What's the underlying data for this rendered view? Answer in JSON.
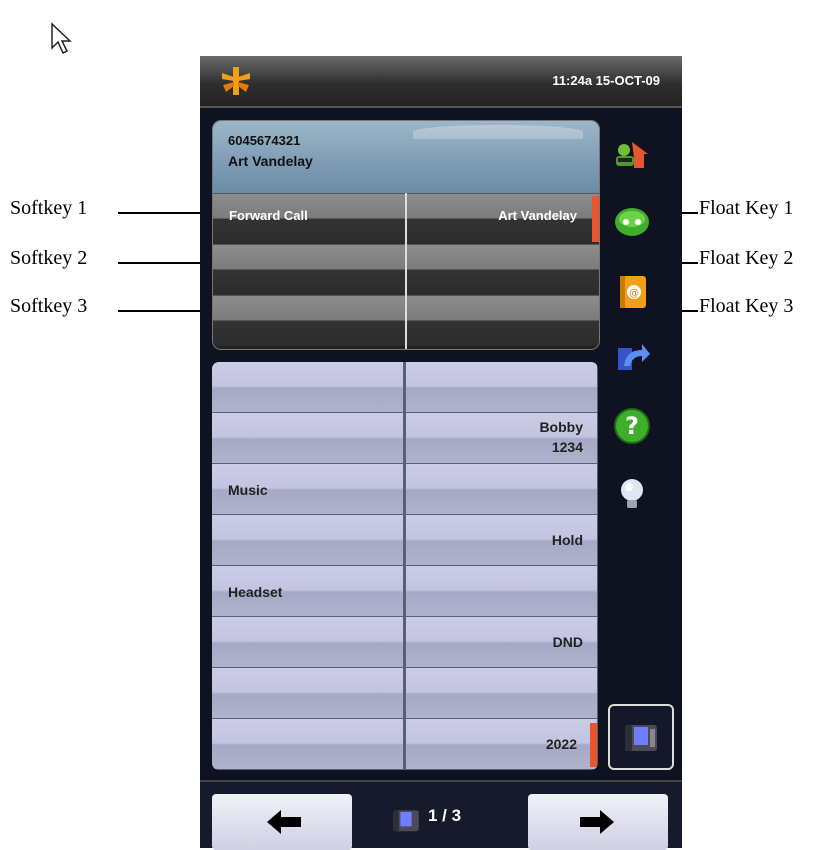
{
  "status_bar": {
    "time": "11:24a 15-OCT-09"
  },
  "caller": {
    "number": "6045674321",
    "name": "Art Vandelay"
  },
  "softkeys": [
    {
      "label": "Forward Call"
    },
    {
      "label": ""
    },
    {
      "label": ""
    }
  ],
  "float_keys": [
    {
      "label": "Art Vandelay"
    },
    {
      "label": ""
    },
    {
      "label": ""
    }
  ],
  "programmable_keys": {
    "left": [
      "",
      "",
      "Music",
      "",
      "Headset",
      "",
      "",
      ""
    ],
    "right": [
      {
        "line1": "",
        "line2": ""
      },
      {
        "line1": "Bobby",
        "line2": "1234"
      },
      {
        "line1": "",
        "line2": ""
      },
      {
        "line1": "Hold",
        "line2": ""
      },
      {
        "line1": "",
        "line2": ""
      },
      {
        "line1": "DND",
        "line2": ""
      },
      {
        "line1": "",
        "line2": ""
      },
      {
        "line1": "2022",
        "line2": ""
      }
    ]
  },
  "navigation": {
    "page": "1 / 3"
  },
  "callouts": {
    "softkey_1": "Softkey 1",
    "softkey_2": "Softkey 2",
    "softkey_3": "Softkey 3",
    "float_key_1": "Float Key 1",
    "float_key_2": "Float Key 2",
    "float_key_3": "Float Key 3"
  },
  "side_icons": [
    "contacts-icon",
    "chat-icon",
    "address-book-icon",
    "transfer-icon",
    "help-icon",
    "lightbulb-icon",
    "phone-icon"
  ],
  "colors": {
    "accent": "#e8562b",
    "key_face": "#c3c4df",
    "panel_bg": "#0f1220"
  }
}
